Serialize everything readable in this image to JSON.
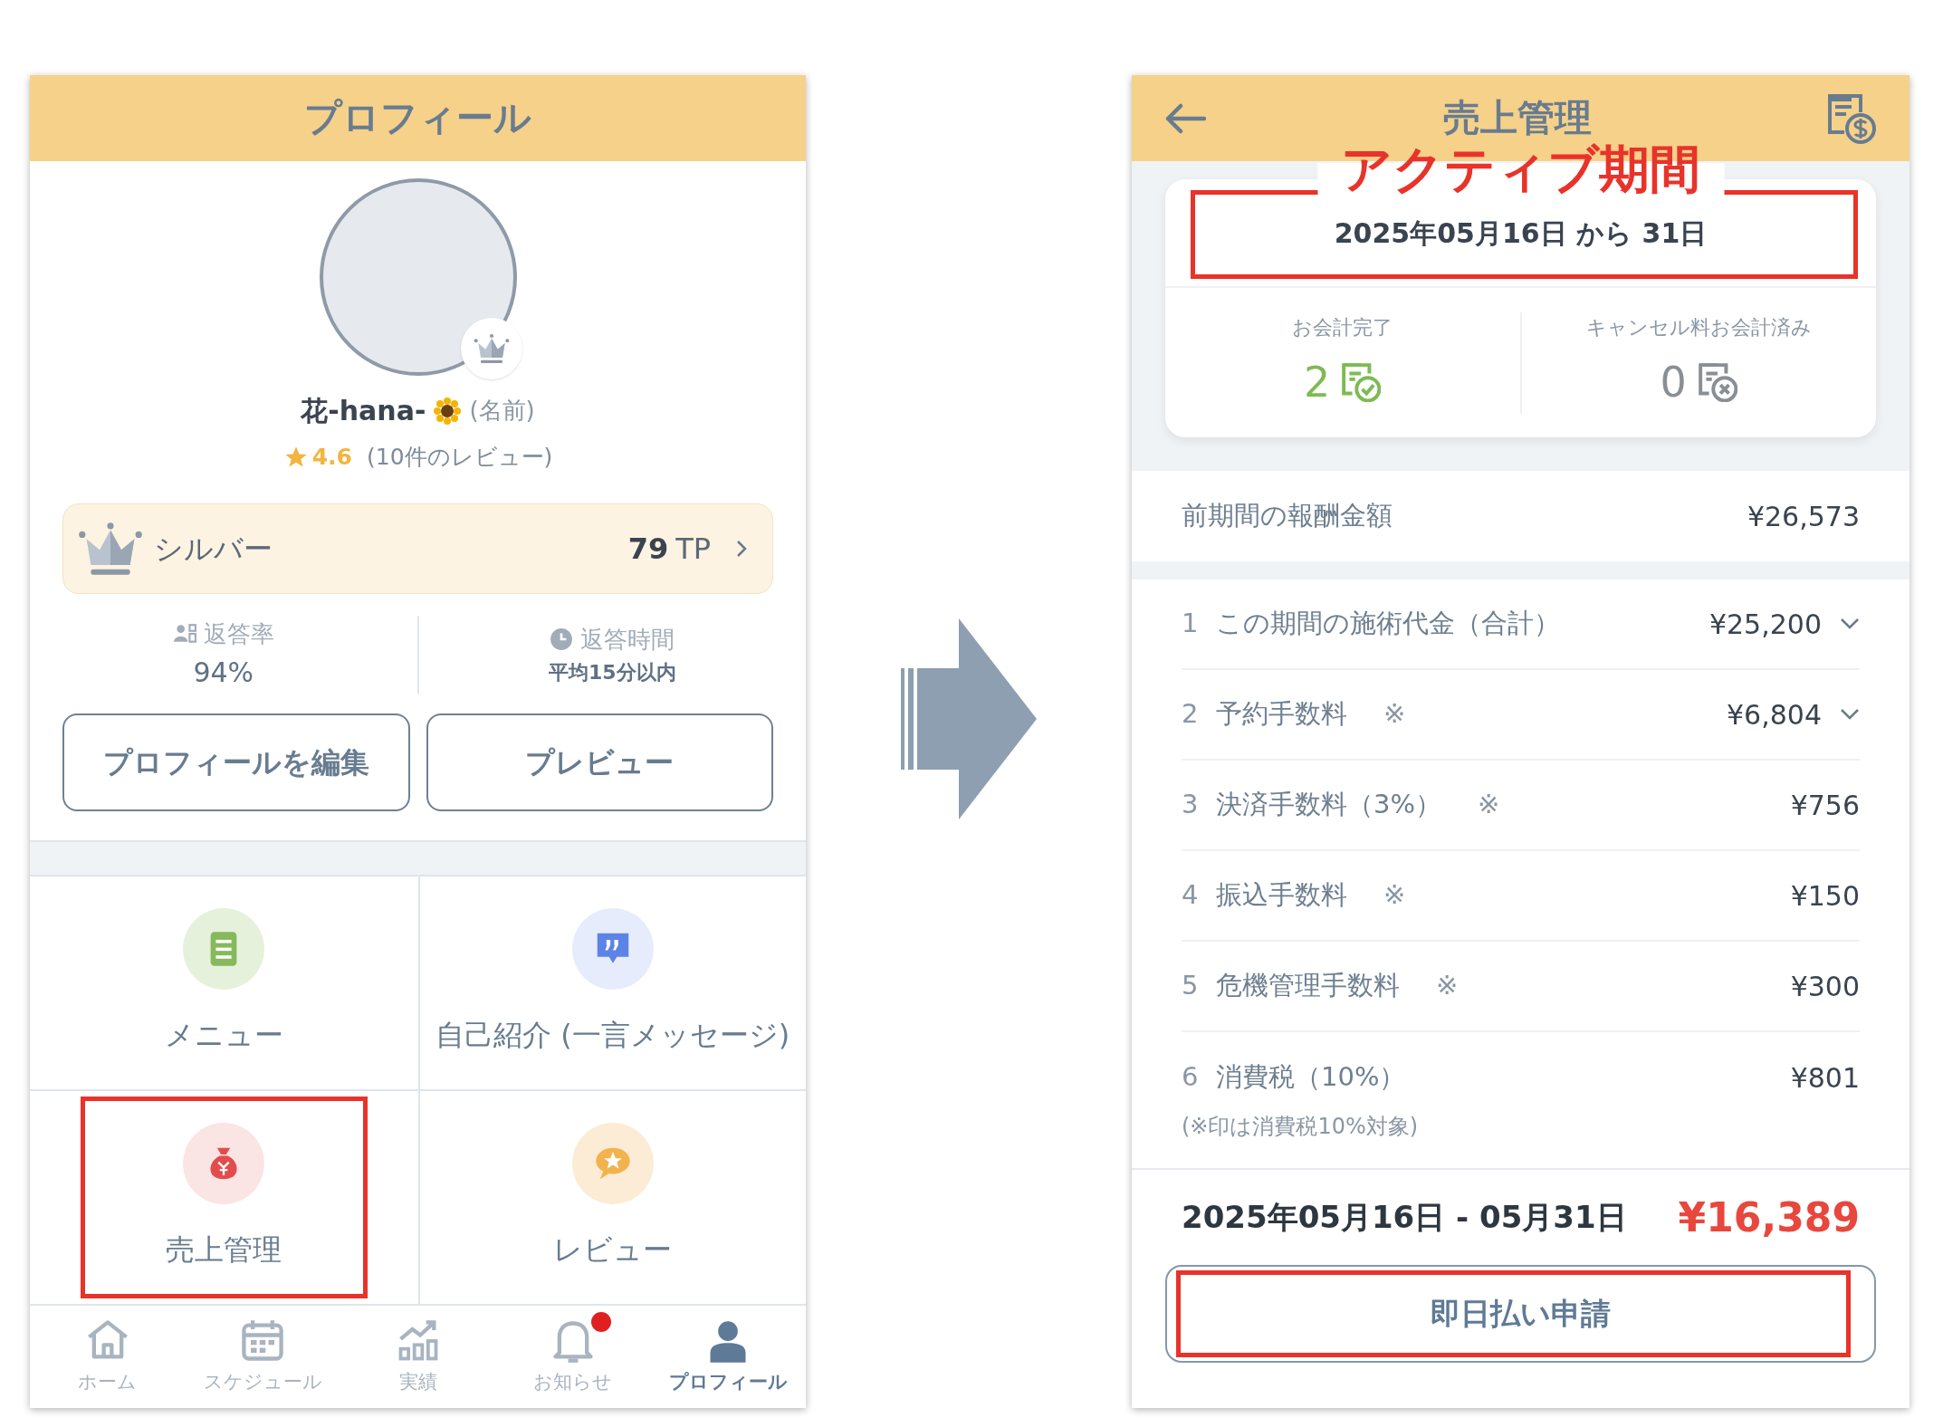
{
  "profile_screen": {
    "title": "プロフィール",
    "name": "花-hana-",
    "name_note": "(名前)",
    "rating": "4.6",
    "review_count": "(10件のレビュー)",
    "rank": {
      "label": "シルバー",
      "points": "79",
      "unit": "TP"
    },
    "stats": [
      {
        "kind": "rate",
        "label": "返答率",
        "value": "94%"
      },
      {
        "kind": "time",
        "label": "返答時間",
        "value": "平均**15分**以内"
      }
    ],
    "buttons": [
      "プロフィールを編集",
      "プレビュー"
    ],
    "menu_tiles": [
      {
        "kind": "menu",
        "label": "メニュー",
        "highlighted": false
      },
      {
        "kind": "intro",
        "label": "自己紹介 (一言メッセージ)",
        "highlighted": false
      },
      {
        "kind": "sales",
        "label": "売上管理",
        "highlighted": true
      },
      {
        "kind": "review",
        "label": "レビュー",
        "highlighted": false
      }
    ],
    "bottom_nav": [
      {
        "kind": "home",
        "label": "ホーム",
        "selected": false,
        "badge": false
      },
      {
        "kind": "schedule",
        "label": "スケジュール",
        "selected": false,
        "badge": false
      },
      {
        "kind": "results",
        "label": "実績",
        "selected": false,
        "badge": false
      },
      {
        "kind": "notice",
        "label": "お知らせ",
        "selected": false,
        "badge": true
      },
      {
        "kind": "profile",
        "label": "プロフィール",
        "selected": true,
        "badge": false
      }
    ]
  },
  "sales_screen": {
    "title": "売上管理",
    "annotation": "アクティブ期間",
    "period": "2025年05月16日 から 31日",
    "period_highlighted": true,
    "counters": [
      {
        "kind": "done",
        "label": "お会計完了",
        "value": "2"
      },
      {
        "kind": "cancelled",
        "label": "キャンセル料お会計済み",
        "value": "0"
      }
    ],
    "previous": {
      "label": "前期間の報酬金額",
      "amount": "¥26,573"
    },
    "rows": [
      {
        "number": "1",
        "label": "この期間の施術代金（合計）",
        "mark": "",
        "amount": "¥25,200",
        "expandable": true
      },
      {
        "number": "2",
        "label": "予約手数料",
        "mark": "※",
        "amount": "¥6,804",
        "expandable": true
      },
      {
        "number": "3",
        "label": "決済手数料（3%）",
        "mark": "※",
        "amount": "¥756",
        "expandable": false
      },
      {
        "number": "4",
        "label": "振込手数料",
        "mark": "※",
        "amount": "¥150",
        "expandable": false
      },
      {
        "number": "5",
        "label": "危機管理手数料",
        "mark": "※",
        "amount": "¥300",
        "expandable": false
      },
      {
        "number": "6",
        "label": "消費税（10%）",
        "mark": "",
        "amount": "¥801",
        "expandable": false
      }
    ],
    "note": "(※印は消費税10%対象)",
    "total": {
      "period": "2025年05月16日 - 05月31日",
      "amount": "¥16,389"
    },
    "button": {
      "label": "即日払い申請",
      "highlighted": true
    }
  }
}
